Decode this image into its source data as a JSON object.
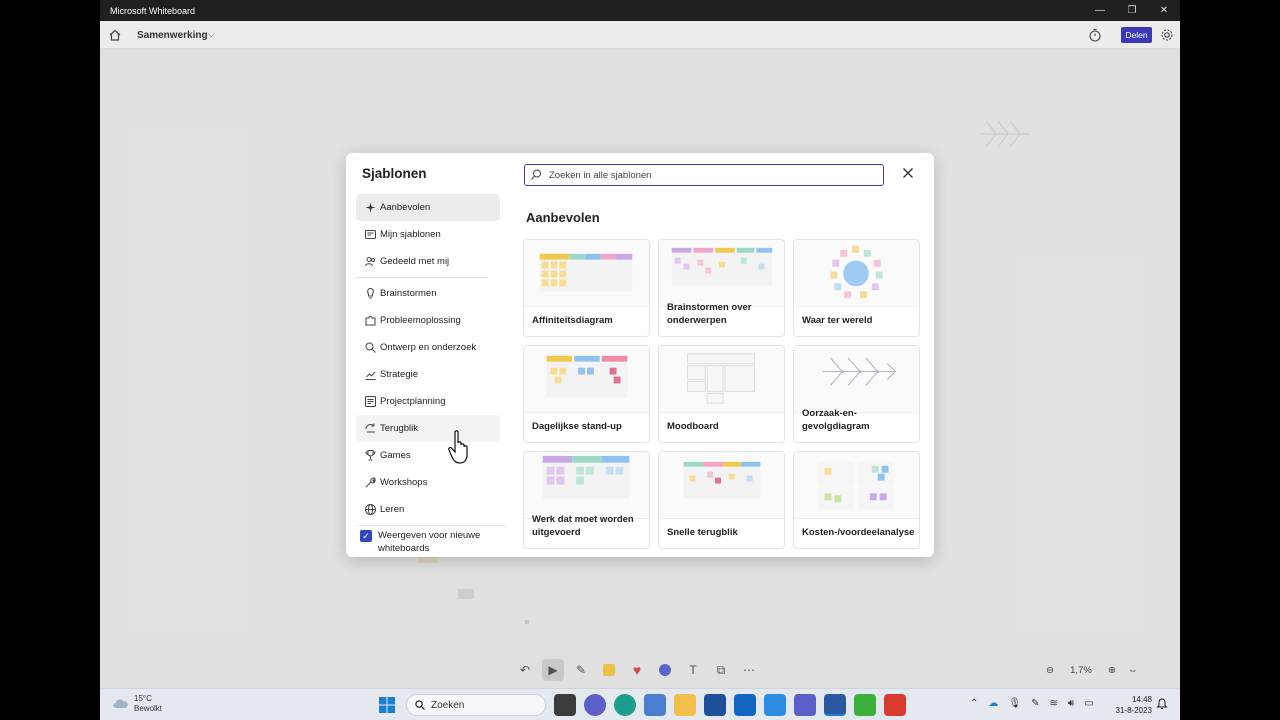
{
  "window": {
    "title": "Microsoft Whiteboard",
    "controls": [
      "—",
      "❐",
      "✕"
    ]
  },
  "appbar": {
    "board_name": "Samenwerking",
    "share_label": "Delen"
  },
  "dialog": {
    "title": "Sjablonen",
    "search_placeholder": "Zoeken in alle sjablonen",
    "section_title": "Aanbevolen",
    "nav_top": [
      {
        "label": "Aanbevolen",
        "icon": "sparkle-icon"
      },
      {
        "label": "Mijn sjablonen",
        "icon": "template-icon"
      },
      {
        "label": "Gedeeld met mij",
        "icon": "people-icon"
      }
    ],
    "nav_categories": [
      {
        "label": "Brainstormen",
        "icon": "lightbulb-icon"
      },
      {
        "label": "Probleemoplossing",
        "icon": "puzzle-icon"
      },
      {
        "label": "Ontwerp en onderzoek",
        "icon": "search-icon"
      },
      {
        "label": "Strategie",
        "icon": "chart-icon"
      },
      {
        "label": "Projectplanning",
        "icon": "list-icon"
      },
      {
        "label": "Terugblik",
        "icon": "retrospective-icon"
      },
      {
        "label": "Games",
        "icon": "trophy-icon"
      },
      {
        "label": "Workshops",
        "icon": "wrench-icon"
      },
      {
        "label": "Leren",
        "icon": "globe-icon"
      }
    ],
    "show_checkbox_label": "Weergeven voor nieuwe whiteboards",
    "show_checkbox_checked": true,
    "templates": [
      {
        "label": "Affiniteitsdiagram"
      },
      {
        "label": "Brainstormen over onderwerpen"
      },
      {
        "label": "Waar ter wereld"
      },
      {
        "label": "Dagelijkse stand-up"
      },
      {
        "label": "Moodboard"
      },
      {
        "label": "Oorzaak-en-gevolgdiagram"
      },
      {
        "label": "Werk dat moet worden uitgevoerd"
      },
      {
        "label": "Snelle terugblik"
      },
      {
        "label": "Kosten-/voordeelanalyse"
      }
    ]
  },
  "zoom": {
    "level": "1,7%"
  },
  "taskbar": {
    "weather_temp": "15°C",
    "weather_desc": "Bewolkt",
    "search_label": "Zoeken",
    "time": "14:48",
    "date": "31-8-2023"
  },
  "colors": {
    "accent": "#3a3ab8",
    "checkbox": "#3346c3"
  }
}
